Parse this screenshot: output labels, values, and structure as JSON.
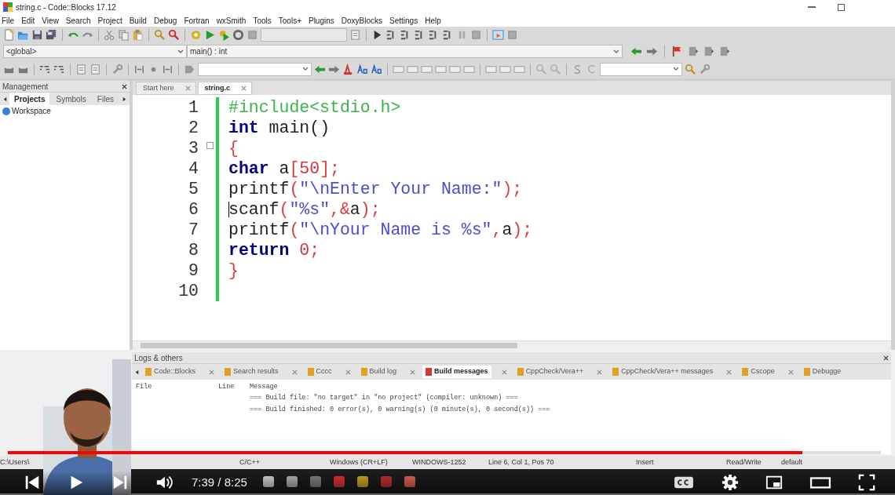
{
  "window": {
    "title": "string.c - Code::Blocks 17.12"
  },
  "menu": [
    "File",
    "Edit",
    "View",
    "Search",
    "Project",
    "Build",
    "Debug",
    "Fortran",
    "wxSmith",
    "Tools",
    "Tools+",
    "Plugins",
    "DoxyBlocks",
    "Settings",
    "Help"
  ],
  "scope_combo": {
    "value": "<global>"
  },
  "function_combo": {
    "value": "main() : int"
  },
  "management": {
    "title": "Management",
    "tabs": [
      {
        "label": "Projects",
        "selected": true
      },
      {
        "label": "Symbols",
        "selected": false
      },
      {
        "label": "Files",
        "selected": false
      }
    ],
    "tree": [
      {
        "label": "Workspace"
      }
    ]
  },
  "editor": {
    "tabs": [
      {
        "label": "Start here",
        "selected": false
      },
      {
        "label": "string.c",
        "selected": true
      }
    ],
    "lines": [
      {
        "number": "1",
        "fold": false,
        "cursor": false,
        "tokens": [
          {
            "t": "#include<stdio.h>",
            "kind": "preproc"
          }
        ]
      },
      {
        "number": "2",
        "fold": false,
        "cursor": false,
        "tokens": [
          {
            "t": "int",
            "kind": "keyword"
          },
          {
            "t": " main()",
            "kind": "plain"
          }
        ]
      },
      {
        "number": "3",
        "fold": true,
        "cursor": false,
        "tokens": [
          {
            "t": "{",
            "kind": "op"
          }
        ]
      },
      {
        "number": "4",
        "fold": false,
        "cursor": false,
        "tokens": [
          {
            "t": "char",
            "kind": "keyword"
          },
          {
            "t": " a",
            "kind": "plain"
          },
          {
            "t": "[",
            "kind": "op"
          },
          {
            "t": "50",
            "kind": "number"
          },
          {
            "t": "];",
            "kind": "op"
          }
        ]
      },
      {
        "number": "5",
        "fold": false,
        "cursor": false,
        "tokens": [
          {
            "t": "printf",
            "kind": "plain"
          },
          {
            "t": "(",
            "kind": "op"
          },
          {
            "t": "\"\\nEnter Your Name:\"",
            "kind": "string"
          },
          {
            "t": ");",
            "kind": "op"
          }
        ]
      },
      {
        "number": "6",
        "fold": false,
        "cursor": true,
        "tokens": [
          {
            "t": "scanf",
            "kind": "plain"
          },
          {
            "t": "(",
            "kind": "op"
          },
          {
            "t": "\"%s\"",
            "kind": "string"
          },
          {
            "t": ",&",
            "kind": "op"
          },
          {
            "t": "a",
            "kind": "plain"
          },
          {
            "t": ");",
            "kind": "op"
          }
        ]
      },
      {
        "number": "7",
        "fold": false,
        "cursor": false,
        "tokens": [
          {
            "t": "printf",
            "kind": "plain"
          },
          {
            "t": "(",
            "kind": "op"
          },
          {
            "t": "\"\\nYour Name is %s\"",
            "kind": "string"
          },
          {
            "t": ",",
            "kind": "op"
          },
          {
            "t": "a",
            "kind": "plain"
          },
          {
            "t": ");",
            "kind": "op"
          }
        ]
      },
      {
        "number": "8",
        "fold": false,
        "cursor": false,
        "tokens": [
          {
            "t": "return",
            "kind": "keyword"
          },
          {
            "t": " 0",
            "kind": "number"
          },
          {
            "t": ";",
            "kind": "op"
          }
        ]
      },
      {
        "number": "9",
        "fold": false,
        "cursor": false,
        "tokens": [
          {
            "t": "}",
            "kind": "op"
          }
        ]
      },
      {
        "number": "10",
        "fold": false,
        "cursor": false
      }
    ]
  },
  "logs": {
    "title": "Logs & others",
    "tabs": [
      {
        "label": "Code::Blocks",
        "selected": false
      },
      {
        "label": "Search results",
        "selected": false
      },
      {
        "label": "Cccc",
        "selected": false
      },
      {
        "label": "Build log",
        "selected": false
      },
      {
        "label": "Build messages",
        "selected": true
      },
      {
        "label": "CppCheck/Vera++",
        "selected": false
      },
      {
        "label": "CppCheck/Vera++ messages",
        "selected": false
      },
      {
        "label": "Cscope",
        "selected": false
      },
      {
        "label": "Debugge",
        "selected": false
      }
    ],
    "columns": [
      "File",
      "Line",
      "Message"
    ],
    "rows": [
      {
        "message": "=== Build file: \"no target\" in \"no project\" (compiler: unknown) ==="
      },
      {
        "message": "=== Build finished: 0 error(s), 0 warning(s) (0 minute(s), 0 second(s)) ==="
      }
    ]
  },
  "status_bar": [
    "C:\\Users\\",
    "C/C++",
    "Windows (CR+LF)",
    "WINDOWS-1252",
    "Line 6, Col 1, Pos 70",
    "Insert",
    "Read/Write",
    "default"
  ],
  "player": {
    "progress": {
      "level": 0.91
    },
    "time": "7:39 / 8:25"
  }
}
